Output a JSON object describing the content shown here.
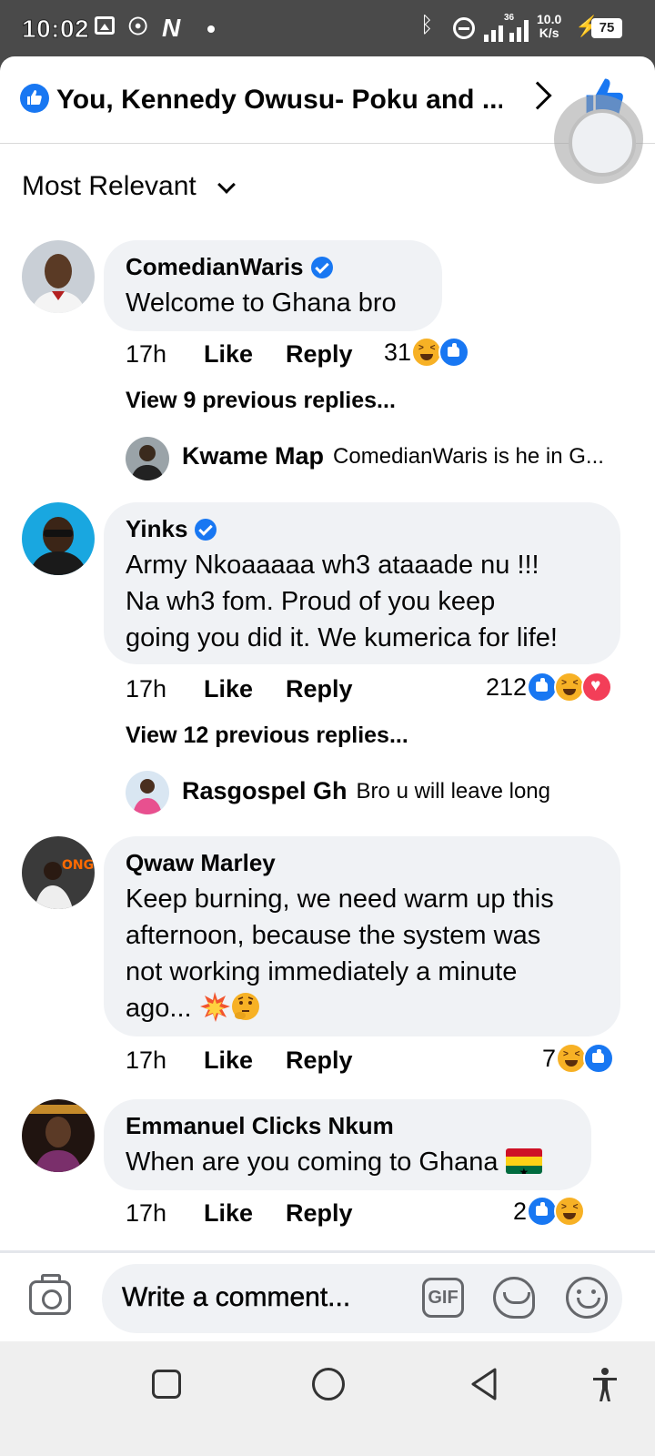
{
  "status_bar": {
    "time": "10:02",
    "network_speed_top": "10.0",
    "network_speed_bottom": "K/s",
    "signal_label": "36",
    "battery": "75"
  },
  "header": {
    "title": "You, Kennedy Owusu- Poku and ..."
  },
  "sort": {
    "label": "Most Relevant"
  },
  "comments": [
    {
      "author": "ComedianWaris",
      "verified": true,
      "text": "Welcome to Ghana bro",
      "time": "17h",
      "like_label": "Like",
      "reply_label": "Reply",
      "reaction_count": "31",
      "reactions": [
        "haha",
        "like"
      ],
      "view_replies": "View 9 previous replies...",
      "latest_reply": {
        "author": "Kwame Map",
        "text": "ComedianWaris is he in G..."
      }
    },
    {
      "author": "Yinks",
      "verified": true,
      "text_lines": [
        "Army Nkoaaaaa wh3 ataaade nu !!!",
        "Na wh3 fom.  Proud of you keep",
        "going you did it. We kumerica for life!"
      ],
      "time": "17h",
      "like_label": "Like",
      "reply_label": "Reply",
      "reaction_count": "212",
      "reactions": [
        "like",
        "haha",
        "love"
      ],
      "view_replies": "View 12 previous replies...",
      "latest_reply": {
        "author": "Rasgospel Gh",
        "text": "Bro u will leave long"
      }
    },
    {
      "author": "Qwaw Marley",
      "verified": false,
      "text_lines": [
        "Keep burning, we need warm up this",
        "afternoon, because the system was",
        "not working immediately a minute",
        "ago..."
      ],
      "emojis": [
        "collision-emoji",
        "thinking-emoji"
      ],
      "time": "17h",
      "like_label": "Like",
      "reply_label": "Reply",
      "reaction_count": "7",
      "reactions": [
        "haha",
        "like"
      ]
    },
    {
      "author": "Emmanuel Clicks Nkum",
      "verified": false,
      "text": "When are you coming to Ghana",
      "emoji": "ghana-flag-emoji",
      "time": "17h",
      "like_label": "Like",
      "reply_label": "Reply",
      "reaction_count": "2",
      "reactions": [
        "like",
        "haha"
      ]
    }
  ],
  "composer": {
    "placeholder": "Write a comment...",
    "gif_label": "GIF"
  },
  "colors": {
    "accent_blue": "#1877f2",
    "bubble_gray": "#f0f2f5",
    "haha_yellow": "#f7b125",
    "love_red": "#f33e58"
  }
}
